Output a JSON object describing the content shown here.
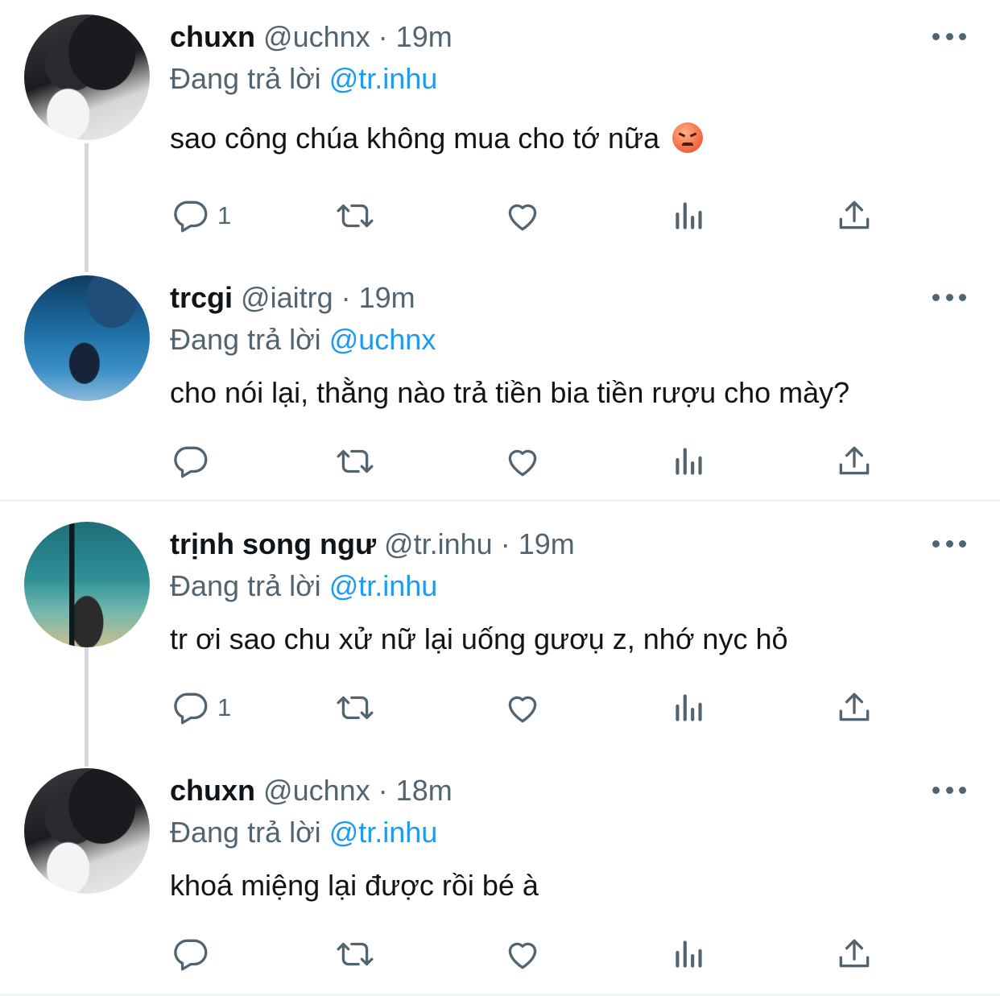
{
  "tweets": [
    {
      "display_name": "chuxn",
      "handle": "@uchnx",
      "time": "19m",
      "replying_prefix": "Đang trả lời",
      "replying_to": "@tr.inhu",
      "text": "sao công chúa không mua cho tớ nữa",
      "emoji": "angry-face-emoji",
      "reply_count": "1",
      "avatar_icon": "avatar-chuxn"
    },
    {
      "display_name": "trcgi",
      "handle": "@iaitrg",
      "time": "19m",
      "replying_prefix": "Đang trả lời",
      "replying_to": "@uchnx",
      "text": "cho nói lại, thằng nào trả tiền bia tiền rượu cho mày?",
      "reply_count": "",
      "avatar_icon": "avatar-trcgi"
    },
    {
      "display_name": "trịnh song ngư",
      "handle": "@tr.inhu",
      "time": "19m",
      "replying_prefix": "Đang trả lời",
      "replying_to": "@tr.inhu",
      "text": "tr ơi sao chu xử nữ lại uống gươụ z, nhớ nyc hỏ",
      "reply_count": "1",
      "avatar_icon": "avatar-trinh-song-ngu"
    },
    {
      "display_name": "chuxn",
      "handle": "@uchnx",
      "time": "18m",
      "replying_prefix": "Đang trả lời",
      "replying_to": "@tr.inhu",
      "text": "khoá miệng lại được rồi bé à",
      "reply_count": "",
      "avatar_icon": "avatar-chuxn"
    }
  ],
  "separator": "·",
  "colors": {
    "text": "#0f1419",
    "secondary": "#536471",
    "mention": "#1d9bf0",
    "thread_line": "#cfd9de",
    "divider": "#eff3f4"
  },
  "icons": [
    "reply-icon",
    "retweet-icon",
    "like-icon",
    "analytics-icon",
    "share-icon",
    "more-icon"
  ]
}
